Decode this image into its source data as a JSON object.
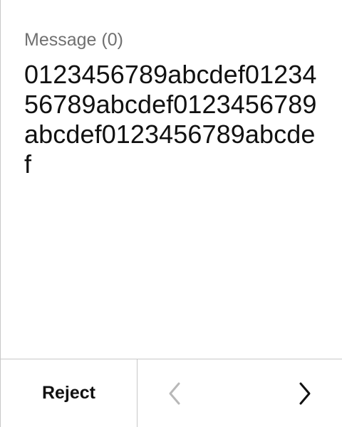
{
  "message": {
    "label": "Message (0)",
    "body": "0123456789abcdef0123456789abcdef0123456789abcdef0123456789abcdef"
  },
  "actions": {
    "reject_label": "Reject"
  },
  "icons": {
    "previous": "chevron-left-icon",
    "next": "chevron-right-icon"
  },
  "colors": {
    "primary_text": "#111111",
    "secondary_text": "#707070",
    "disabled_icon": "#b8b8b8",
    "divider": "#c8c8c8"
  }
}
